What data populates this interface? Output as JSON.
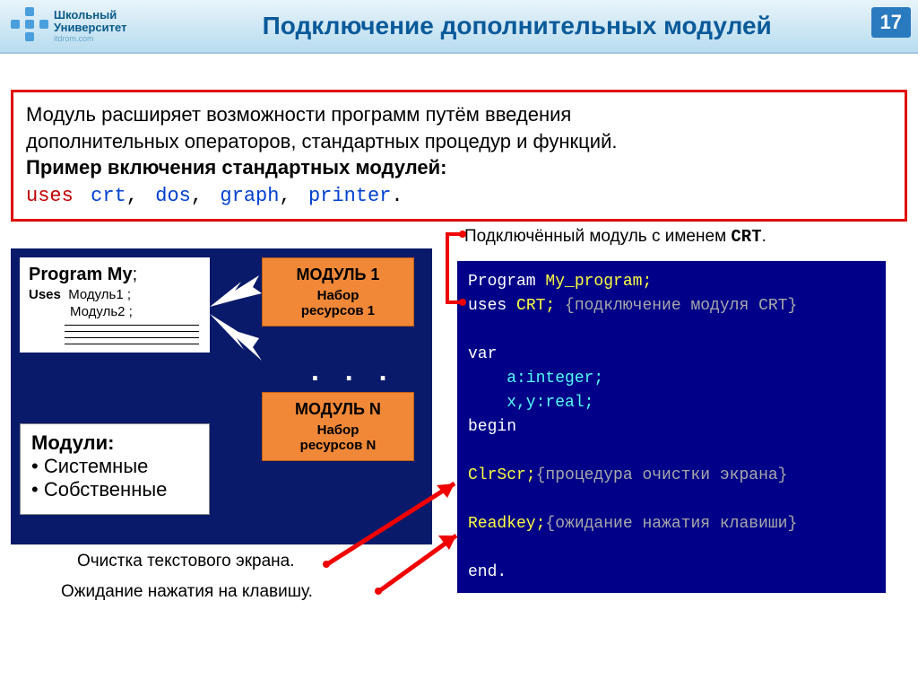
{
  "header": {
    "logo_line1": "Школьный",
    "logo_line2": "Университет",
    "logo_sub": "itdrom.com",
    "title": "Подключение дополнительных модулей",
    "page": "17"
  },
  "redbox": {
    "line1": "Модуль расширяет возможности программ путём введения",
    "line2": "дополнительных операторов, стандартных процедур и функций.",
    "line3": "Пример включения стандартных модулей:",
    "kw_uses": "uses",
    "kw_crt": "crt",
    "kw_dos": "dos",
    "kw_graph": "graph",
    "kw_printer": "printer",
    "comma": ",",
    "period": "."
  },
  "program": {
    "title": "Program My",
    "semi": ";",
    "uses": "Uses",
    "mod1": "Модуль1 ;",
    "mod2": "Модуль2 ;"
  },
  "module1": {
    "title": "МОДУЛЬ 1",
    "sub1": "Набор",
    "sub2": "ресурсов 1"
  },
  "moduleN": {
    "title": "МОДУЛЬ N",
    "sub1": "Набор",
    "sub2": "ресурсов N"
  },
  "dots": ". . .",
  "modules": {
    "title": "Модули:",
    "i1": "• Системные",
    "i2": "• Собственные"
  },
  "captions": {
    "top": "Подключённый модуль с именем ",
    "top_b": "CRT",
    "clear": "Очистка текстового экрана.",
    "wait": "Ожидание нажатия на клавишу."
  },
  "code": {
    "l1a": "Program",
    "l1b": " My_program;",
    "l2a": "uses",
    "l2b": " CRT; ",
    "l2c": "{подключение модуля CRT}",
    "l3": " ",
    "l4": "var",
    "l5": "    a:integer;",
    "l6": "    x,y:real;",
    "l7": "begin",
    "l8": " ",
    "l9a": "ClrScr;",
    "l9b": "{процедура очистки экрана}",
    "l10": " ",
    "l11a": "Readkey;",
    "l11b": "{ожидание нажатия клавиши}",
    "l12": " ",
    "l13": "end."
  }
}
